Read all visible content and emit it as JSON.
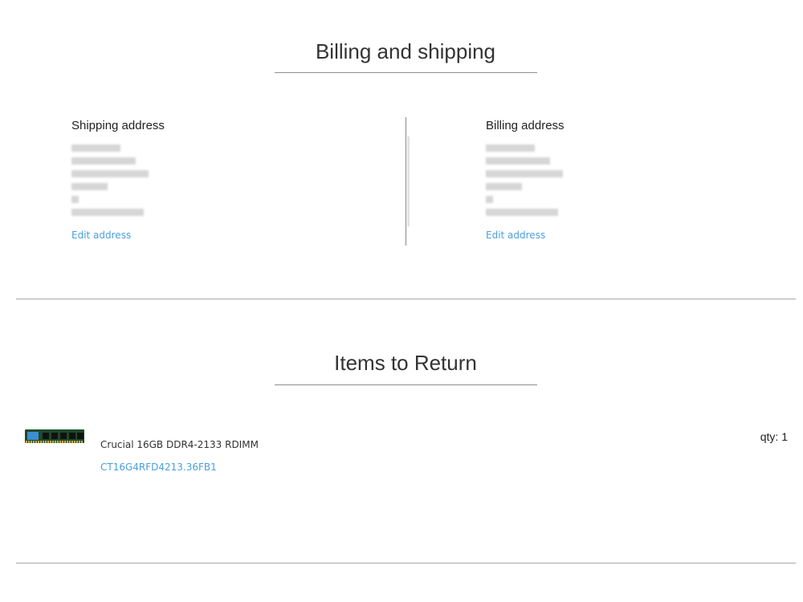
{
  "billing_section": {
    "title": "Billing and shipping",
    "shipping": {
      "heading": "Shipping address",
      "edit_label": "Edit address"
    },
    "billing": {
      "heading": "Billing address",
      "edit_label": "Edit address"
    }
  },
  "returns_section": {
    "title": "Items to Return",
    "items": [
      {
        "name": "Crucial 16GB DDR4-2133 RDIMM",
        "sku": "CT16G4RFD4213.36FB1",
        "qty_text": "qty: 1",
        "image": "ram-module-thumbnail"
      }
    ]
  },
  "colors": {
    "link": "#4a9fdc",
    "rule": "#a9a9a9",
    "text": "#2a2a2a"
  }
}
